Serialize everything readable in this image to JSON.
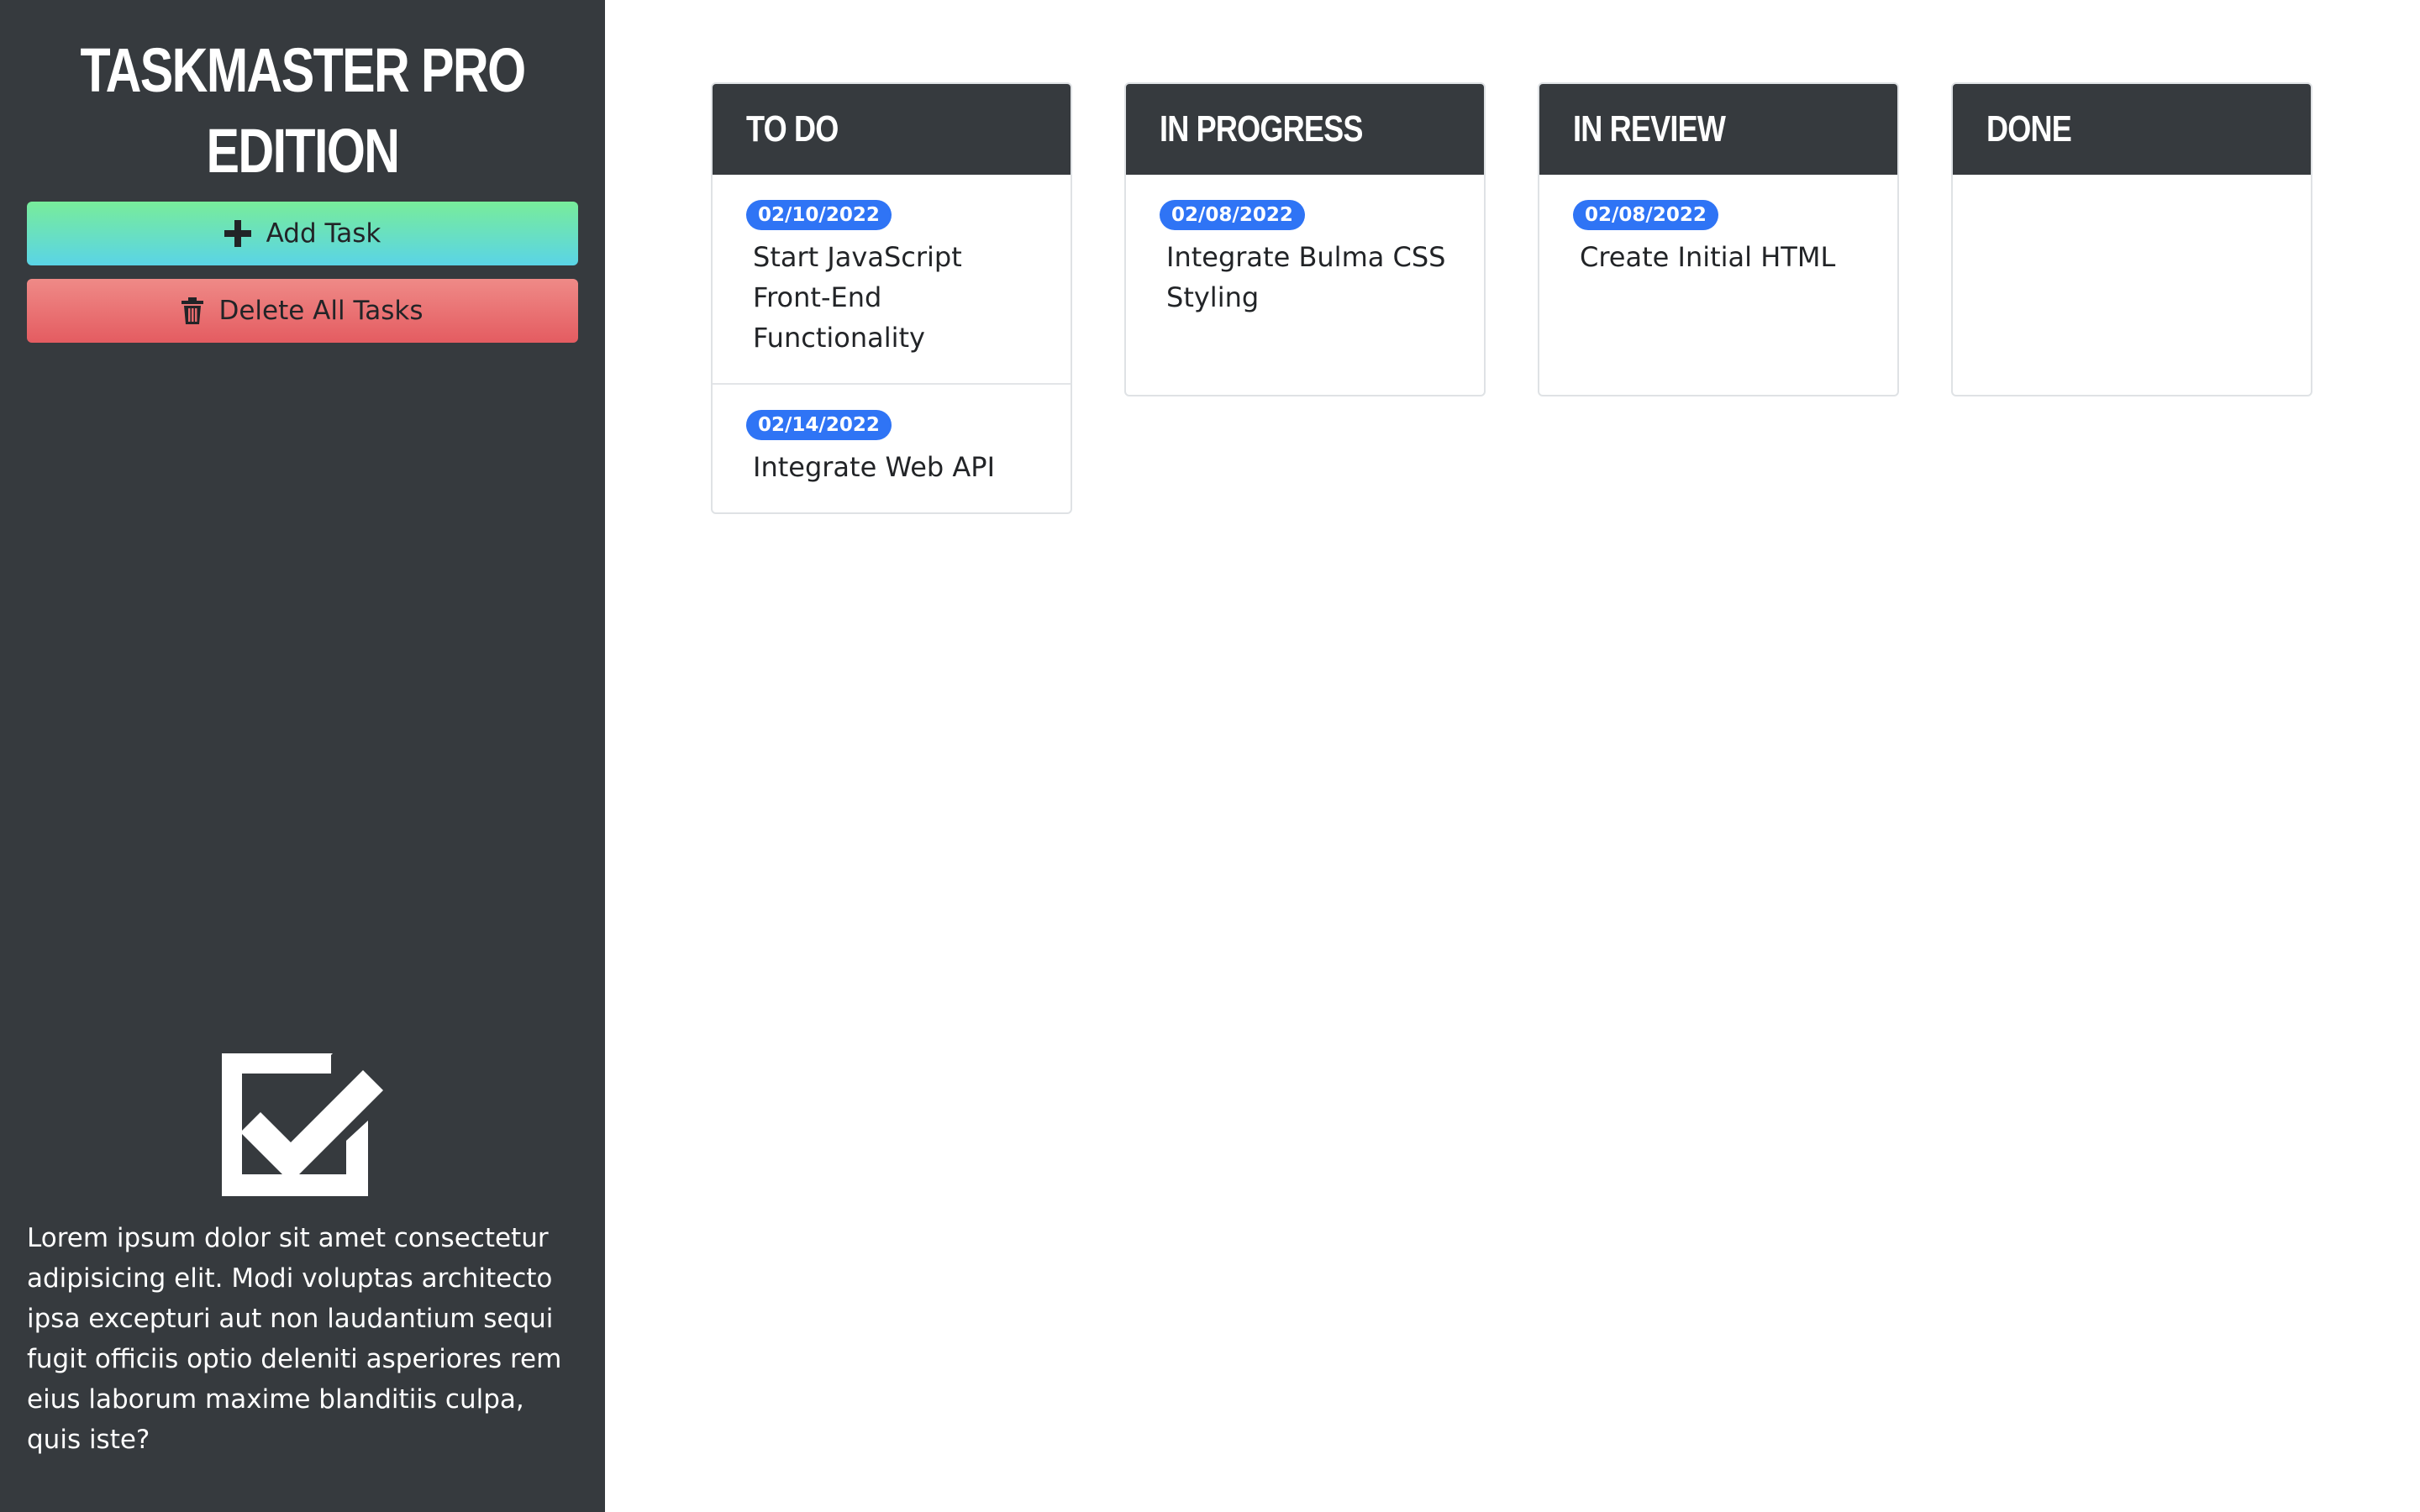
{
  "sidebar": {
    "title_line1": "Taskmaster Pro",
    "title_line2": "Edition",
    "add_task_label": "Add Task",
    "delete_all_label": "Delete All Tasks",
    "description": "Lorem ipsum dolor sit amet consectetur adipisicing elit. Modi voluptas architecto ipsa excepturi aut non laudantium sequi fugit officiis optio deleniti asperiores rem eius laborum maxime blanditiis culpa, quis iste?",
    "icons": {
      "add": "plus-icon",
      "delete": "trash-icon",
      "logo": "checkbox-check-icon"
    }
  },
  "board": {
    "columns": [
      {
        "title": "To Do",
        "tasks": [
          {
            "date": "02/10/2022",
            "title": "Start JavaScript Front-End Functionality"
          },
          {
            "date": "02/14/2022",
            "title": "Integrate Web API"
          }
        ]
      },
      {
        "title": "In Progress",
        "tasks": [
          {
            "date": "02/08/2022",
            "title": "Integrate Bulma CSS Styling"
          }
        ]
      },
      {
        "title": "In Review",
        "tasks": [
          {
            "date": "02/08/2022",
            "title": "Create Initial HTML"
          }
        ]
      },
      {
        "title": "Done",
        "tasks": []
      }
    ]
  },
  "colors": {
    "sidebar_bg": "#363a3e",
    "header_bg": "#363a3e",
    "badge_bg": "#2f74f5",
    "add_gradient_top": "#78ec9a",
    "add_gradient_bottom": "#5ad4e6",
    "delete_gradient_top": "#ef8a87",
    "delete_gradient_bottom": "#e45c61"
  }
}
